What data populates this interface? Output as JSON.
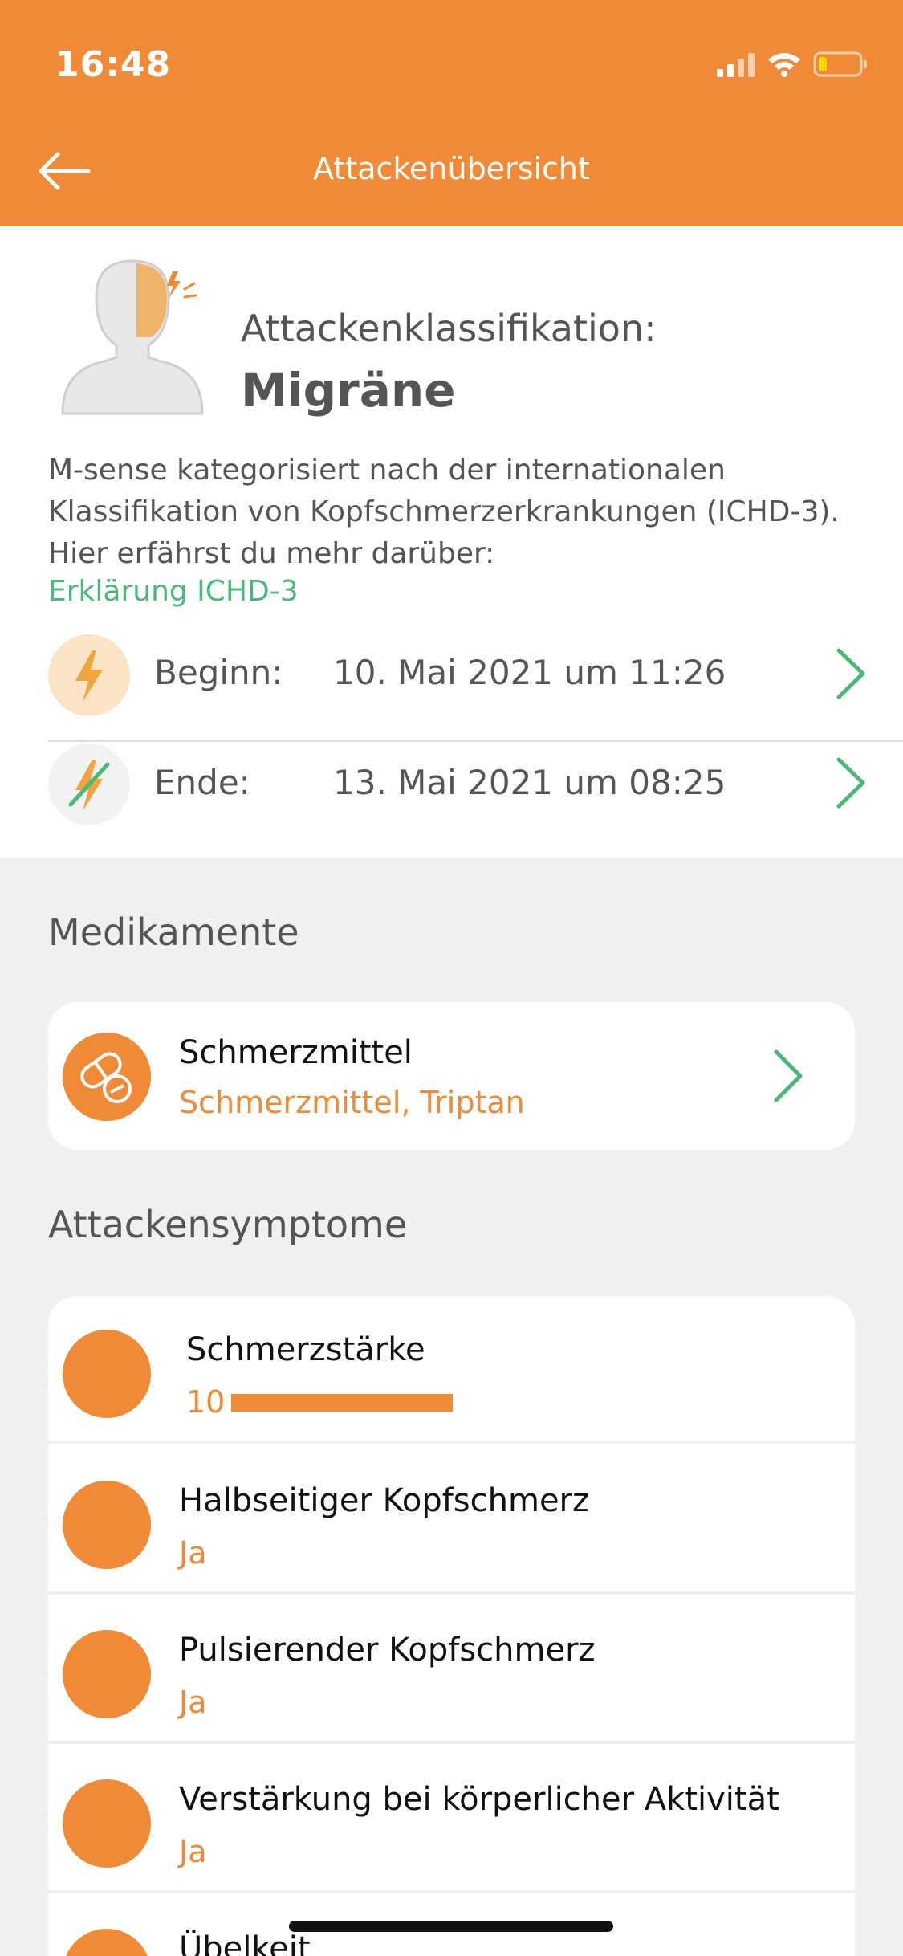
{
  "status": {
    "time": "16:48"
  },
  "nav": {
    "title": "Attackenübersicht"
  },
  "classification": {
    "label": "Attackenklassifikation:",
    "value": "Migräne",
    "description": "M-sense kategorisiert nach der internationalen Klassifikation von Kopfschmerzerkrankungen (ICHD-3). Hier erfährst du mehr darüber:",
    "link": "Erklärung ICHD-3"
  },
  "timing": {
    "start": {
      "label": "Beginn:",
      "value": "10. Mai 2021 um 11:26"
    },
    "end": {
      "label": "Ende:",
      "value": "13. Mai 2021 um 08:25"
    }
  },
  "medications": {
    "section_title": "Medikamente",
    "item": {
      "title": "Schmerzmittel",
      "subtitle": "Schmerzmittel, Triptan"
    }
  },
  "symptoms": {
    "section_title": "Attackensymptome",
    "items": [
      {
        "title": "Schmerzstärke",
        "value": "10",
        "level": 1.0
      },
      {
        "title": "Halbseitiger Kopfschmerz",
        "value": "Ja"
      },
      {
        "title": "Pulsierender Kopfschmerz",
        "value": "Ja"
      },
      {
        "title": "Verstärkung bei körperlicher Aktivität",
        "value": "Ja"
      },
      {
        "title": "Übelkeit",
        "value": ""
      }
    ]
  },
  "colors": {
    "accent": "#f08a37",
    "link": "#4cb878",
    "background": "#f0f0f0"
  }
}
